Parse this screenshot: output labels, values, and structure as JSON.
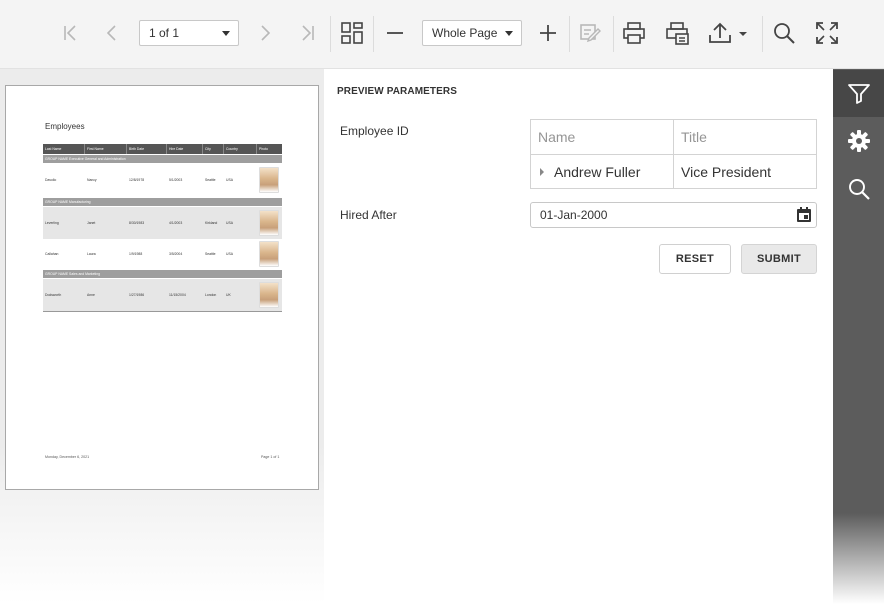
{
  "toolbar": {
    "page_selector": "1 of 1",
    "zoom_selector": "Whole Page"
  },
  "report": {
    "title": "Employees",
    "columns": [
      "Last Name",
      "First Name",
      "Birth Date",
      "Hire Date",
      "City",
      "Country",
      "Photo"
    ],
    "groups": [
      {
        "label": "GROUP NAME  Executive General and Administration",
        "rows": [
          {
            "last": "Davolio",
            "first": "Nancy",
            "birth": "12/8/1978",
            "hire": "5/1/2003",
            "city": "Seattle",
            "country": "USA"
          }
        ]
      },
      {
        "label": "GROUP NAME  Manufacturing",
        "rows": [
          {
            "last": "Leverling",
            "first": "Janet",
            "birth": "8/30/1983",
            "hire": "4/1/2003",
            "city": "Kirkland",
            "country": "USA"
          },
          {
            "last": "Callahan",
            "first": "Laura",
            "birth": "1/9/1988",
            "hire": "3/5/2004",
            "city": "Seattle",
            "country": "USA"
          }
        ]
      },
      {
        "label": "GROUP NAME  Sales and Marketing",
        "rows": [
          {
            "last": "Dodsworth",
            "first": "Anne",
            "birth": "1/27/1986",
            "hire": "11/15/2004",
            "city": "London",
            "country": "UK"
          }
        ]
      }
    ],
    "footer_left": "Monday, December 6, 2021",
    "footer_right": "Page 1 of 1"
  },
  "params": {
    "title": "PREVIEW PARAMETERS",
    "employee_id_label": "Employee ID",
    "lookup_headers": [
      "Name",
      "Title"
    ],
    "lookup_row": {
      "name": "Andrew Fuller",
      "title": "Vice President"
    },
    "hired_after_label": "Hired After",
    "hired_after_value": "01-Jan-2000",
    "reset_label": "RESET",
    "submit_label": "SUBMIT"
  },
  "colors": {
    "toolbar_bg": "#f4f4f4",
    "right_bar_bg": "#5c5c5c",
    "right_bar_active": "#474747",
    "report_header_bg": "#555555",
    "report_group_bg": "#9e9e9e"
  },
  "icons": {
    "toolbar": [
      "first-page-icon",
      "previous-page-icon",
      "next-page-icon",
      "last-page-icon",
      "multipage-icon",
      "zoom-out-icon",
      "zoom-in-icon",
      "editing-fields-icon",
      "print-icon",
      "print-page-icon",
      "export-icon",
      "search-icon",
      "fullscreen-icon"
    ],
    "right_bar": [
      "filter-icon",
      "gear-icon",
      "search-icon"
    ]
  }
}
